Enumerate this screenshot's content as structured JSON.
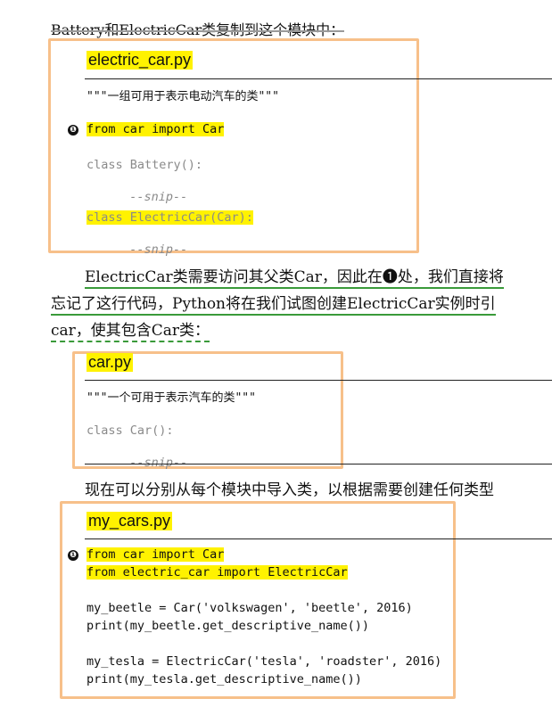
{
  "intro_line": "Battery和ElectricCar类复制到这个模块中：",
  "block1": {
    "title": "electric_car.py",
    "docstring": "\"\"\"一组可用于表示电动汽车的类\"\"\"",
    "marker": "❶",
    "import_line": "from car import Car",
    "class_battery": "class Battery():",
    "snip1": "--snip--",
    "class_electric": "class ElectricCar(Car):",
    "snip2": "--snip--"
  },
  "para1": {
    "line1": "ElectricCar类需要访问其父类Car，因此在❶处，我们直接将",
    "line2": "忘记了这行代码，Python将在我们试图创建ElectricCar实例时引",
    "line3": "car，使其包含Car类："
  },
  "block2": {
    "title": "car.py",
    "docstring": "\"\"\"一个可用于表示汽车的类\"\"\"",
    "class_car": "class Car():",
    "snip": "--snip--"
  },
  "para2": "现在可以分别从每个模块中导入类，以根据需要创建任何类型",
  "block3": {
    "title": "my_cars.py",
    "marker": "❶",
    "import1": "from car import Car",
    "import2": "from electric_car import ElectricCar",
    "line1": "my_beetle = Car('volkswagen', 'beetle', 2016)",
    "line2": "print(my_beetle.get_descriptive_name())",
    "line3": "my_tesla = ElectricCar('tesla', 'roadster', 2016)",
    "line4": "print(my_tesla.get_descriptive_name())"
  },
  "colors": {
    "highlight": "#fff200",
    "box_border": "#f7c08a",
    "underline": "#3a9a3a",
    "code_gray": "#8a8a8a"
  }
}
